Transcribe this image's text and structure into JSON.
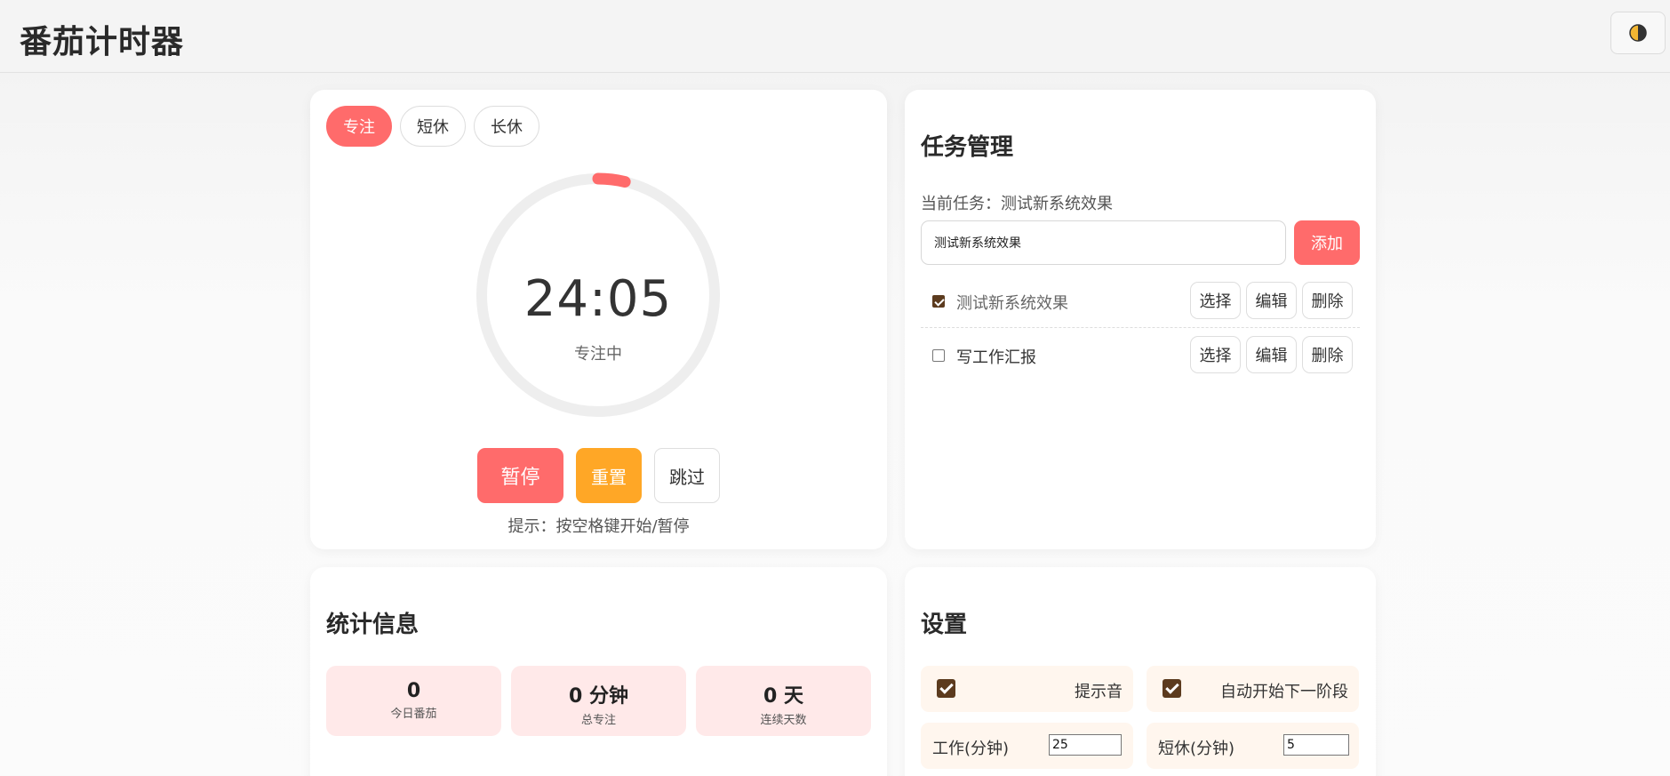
{
  "app": {
    "title": "番茄计时器"
  },
  "theme_toggle": {
    "icon": "half-moon-icon"
  },
  "timer": {
    "modes": [
      {
        "label": "专注",
        "active": true
      },
      {
        "label": "短休",
        "active": false
      },
      {
        "label": "长休",
        "active": false
      }
    ],
    "time": "24:05",
    "status": "专注中",
    "progress": 0.037,
    "pause_label": "暂停",
    "reset_label": "重置",
    "skip_label": "跳过",
    "hint": "提示：按空格键开始/暂停",
    "colors": {
      "accent": "#ff6b6b",
      "reset": "#ffa726",
      "track": "#eeeeee"
    }
  },
  "tasks": {
    "title": "任务管理",
    "current": "当前任务：测试新系统效果",
    "input_value": "测试新系统效果",
    "add_label": "添加",
    "items": [
      {
        "label": "测试新系统效果",
        "done": true
      },
      {
        "label": "写工作汇报",
        "done": false
      }
    ],
    "select_label": "选择",
    "edit_label": "编辑",
    "delete_label": "删除"
  },
  "stats": {
    "title": "统计信息",
    "items": [
      {
        "value": "0",
        "label": "今日番茄"
      },
      {
        "value": "0 分钟",
        "label": "总专注"
      },
      {
        "value": "0 天",
        "label": "连续天数"
      }
    ]
  },
  "settings": {
    "title": "设置",
    "sound_label": "提示音",
    "sound_on": true,
    "auto_label": "自动开始下一阶段",
    "auto_on": true,
    "work_label": "工作(分钟)",
    "work_value": "25",
    "short_label": "短休(分钟)",
    "short_value": "5"
  }
}
